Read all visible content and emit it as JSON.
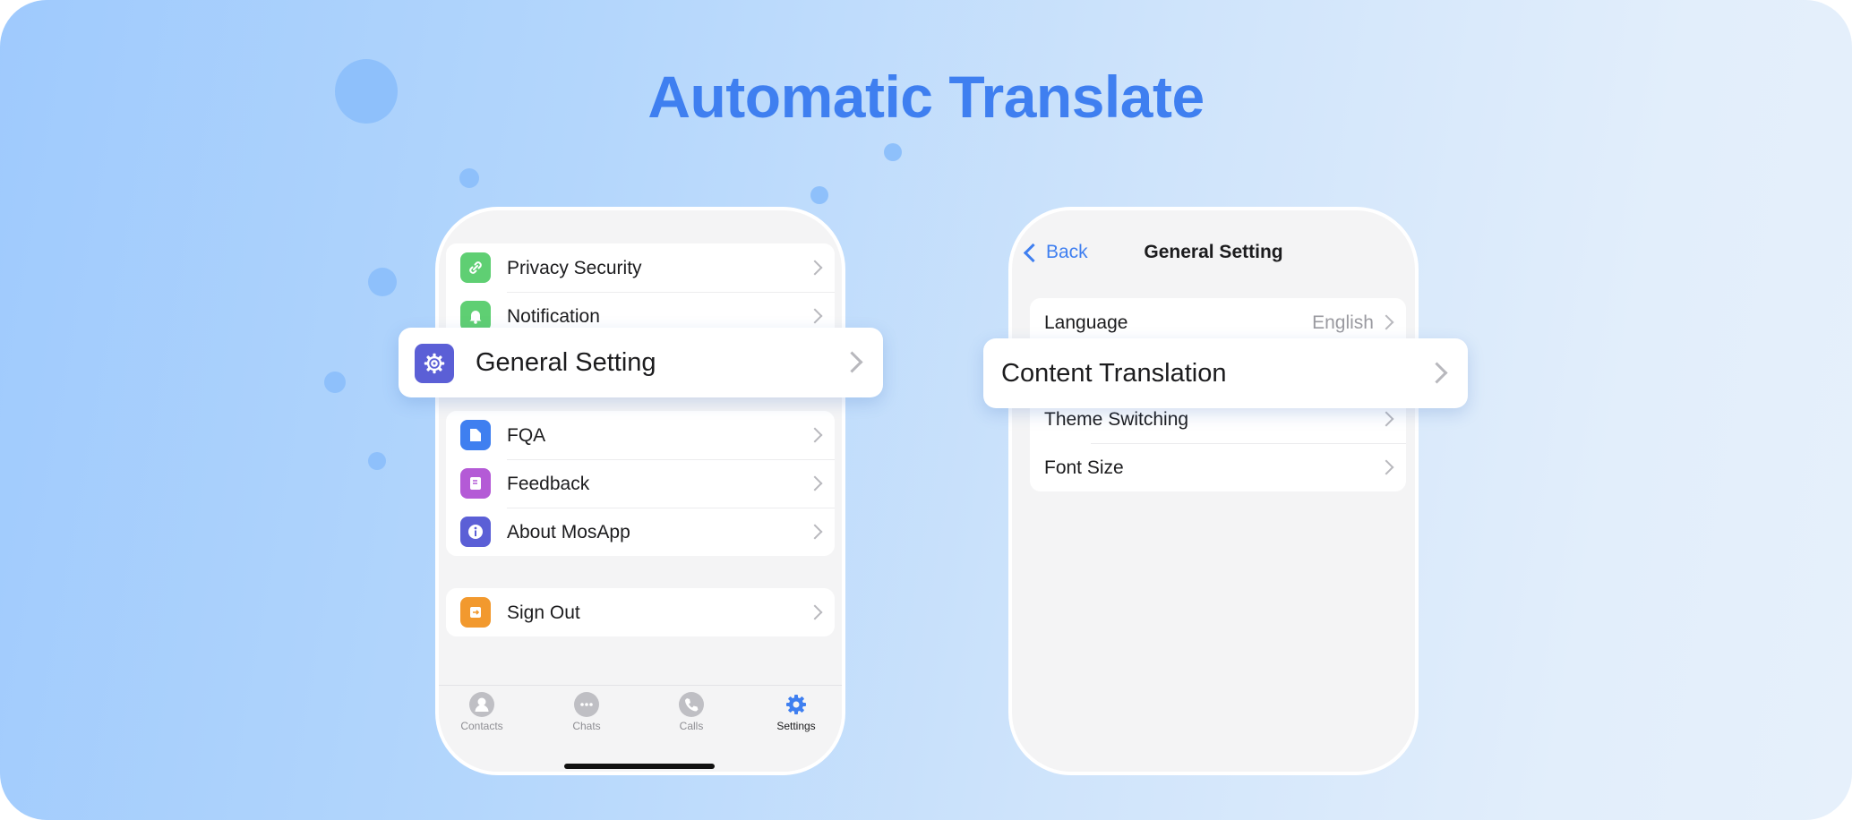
{
  "headline": "Automatic Translate",
  "left_phone": {
    "top_group": [
      {
        "label": "Privacy Security",
        "icon": "link-icon",
        "color": "#5fcf73"
      },
      {
        "label": "Notification",
        "icon": "bell-icon",
        "color": "#5fcf73"
      }
    ],
    "highlight": {
      "label": "General Setting",
      "icon": "gear-icon",
      "color": "#5b5fd6"
    },
    "mid_group": [
      {
        "label": "FQA",
        "icon": "folder-icon",
        "color": "#3f7ff0"
      },
      {
        "label": "Feedback",
        "icon": "book-icon",
        "color": "#b45ad6"
      },
      {
        "label": "About MosApp",
        "icon": "info-icon",
        "color": "#5b5fd6"
      }
    ],
    "bottom_group": [
      {
        "label": "Sign Out",
        "icon": "exit-icon",
        "color": "#f2992e"
      }
    ],
    "tabs": [
      {
        "label": "Contacts",
        "icon": "person-icon"
      },
      {
        "label": "Chats",
        "icon": "chat-bubble-icon"
      },
      {
        "label": "Calls",
        "icon": "phone-icon"
      },
      {
        "label": "Settings",
        "icon": "gear-icon",
        "active": true
      }
    ]
  },
  "right_phone": {
    "back_label": "Back",
    "title": "General Setting",
    "rows": [
      {
        "label": "Language",
        "value": "English"
      },
      {
        "label": "Theme Switching"
      },
      {
        "label": "Font Size"
      }
    ],
    "highlight": {
      "label": "Content Translation"
    }
  },
  "colors": {
    "accent": "#3f7ff0",
    "active_tab": "#3f7ff0"
  }
}
